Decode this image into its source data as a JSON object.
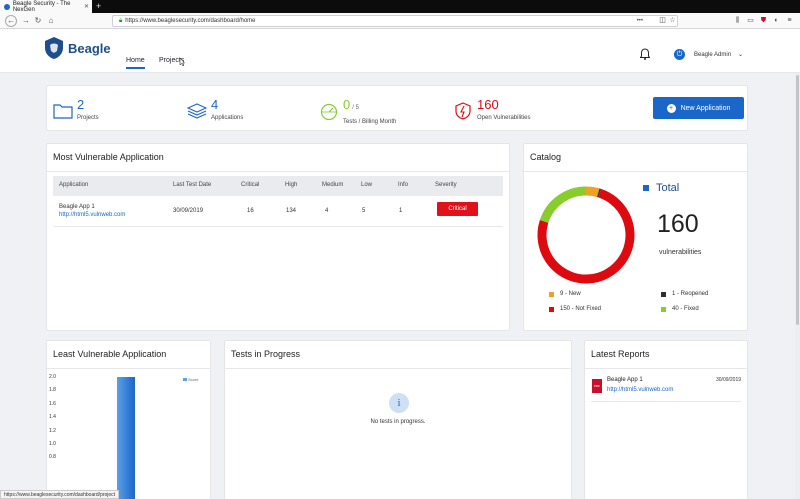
{
  "browser": {
    "tab_title": "Beagle Security - The NexGen",
    "url": "https://www.beaglesecurity.com/dashboard/home",
    "status_url": "https://www.beaglesecurity.com/dashboard/project"
  },
  "header": {
    "brand": "Beagle",
    "nav": [
      {
        "label": "Home",
        "active": true
      },
      {
        "label": "Projects",
        "active": false
      }
    ],
    "user": "Beagle Admin"
  },
  "stats": [
    {
      "value": "2",
      "suffix": "",
      "label": "Projects",
      "icon": "folder-icon"
    },
    {
      "value": "4",
      "suffix": "",
      "label": "Applications",
      "icon": "layers-icon"
    },
    {
      "value": "0",
      "suffix": "/ 5",
      "label": "Tests / Billing Month",
      "icon": "speedometer-icon"
    },
    {
      "value": "160",
      "suffix": "",
      "label": "Open Vulnerabilities",
      "icon": "shield-alert-icon"
    }
  ],
  "new_app_button": "New Application",
  "most_vulnerable": {
    "title": "Most Vulnerable Application",
    "columns": [
      "Application",
      "Last Test Date",
      "Critical",
      "High",
      "Medium",
      "Low",
      "Info",
      "Severity"
    ],
    "rows": [
      {
        "name": "Beagle App 1",
        "url": "http://html5.vulnweb.com",
        "date": "30/09/2019",
        "critical": "16",
        "high": "134",
        "medium": "4",
        "low": "5",
        "info": "1",
        "severity": "Critical"
      }
    ]
  },
  "catalog": {
    "title": "Catalog",
    "total_label": "Total",
    "total": "160",
    "total_sub": "vulnerabilities",
    "legend": [
      {
        "label": "9 - New",
        "value": 9,
        "color": "#f0a023"
      },
      {
        "label": "1 - Reopened",
        "value": 1,
        "color": "#2a2f36"
      },
      {
        "label": "150 - Not Fixed",
        "value": 150,
        "color": "#dd0b10"
      },
      {
        "label": "40 - Fixed",
        "value": 40,
        "color": "#88cc2e"
      }
    ]
  },
  "least_vulnerable": {
    "title": "Least Vulnerable Application",
    "legend": "Score",
    "y_ticks": [
      "2.0",
      "1.8",
      "1.6",
      "1.4",
      "1.2",
      "1.0",
      "0.8"
    ],
    "bar_value": 2.0
  },
  "tests_in_progress": {
    "title": "Tests in Progress",
    "empty_text": "No tests in progress."
  },
  "latest_reports": {
    "title": "Latest Reports",
    "items": [
      {
        "name": "Beagle App 1",
        "url": "http://html5.vulnweb.com",
        "date": "30/09/2019",
        "icon_text": "PDF"
      }
    ]
  }
}
